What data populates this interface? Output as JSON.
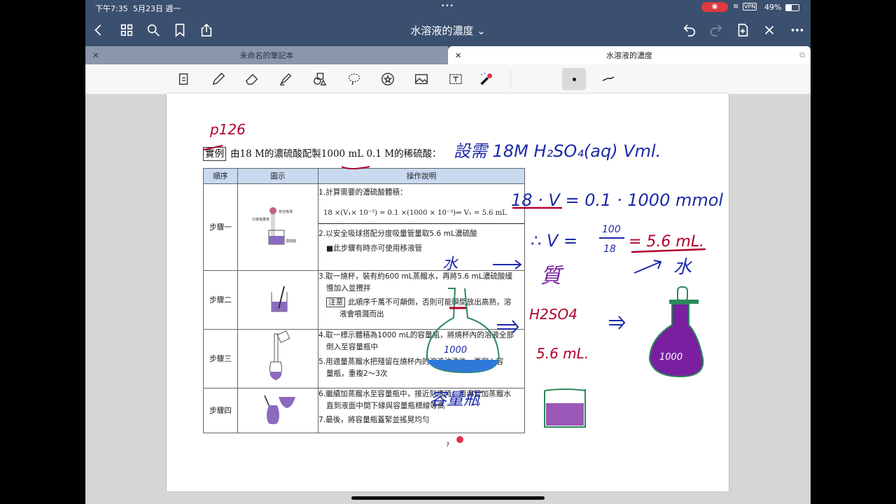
{
  "status": {
    "time": "下午7:35",
    "date": "5月23日 週一",
    "battery": "49%",
    "vpn": "VPN"
  },
  "nav": {
    "title": "水溶液的濃度 ⌄"
  },
  "tabs": [
    {
      "label": "未命名的筆記本"
    },
    {
      "label": "水溶液的濃度"
    }
  ],
  "document": {
    "example_tag": "實例",
    "heading": "由18 M的濃硫酸配製1000 mL 0.1 M的稀硫酸：",
    "columns": [
      "順序",
      "圖示",
      "操作說明"
    ],
    "steps": [
      {
        "label": "步驟一",
        "lines": [
          "1.計算需要的濃硫酸體積：",
          "18 ×(V₁× 10⁻³) = 0.1 ×(1000 × 10⁻³)⇒ V₁ = 5.6 mL",
          "2.以安全吸球搭配分度吸量管量取5.6 mL濃硫酸",
          "■此步驟有時亦可使用移液管"
        ],
        "fig_labels": [
          "安全吸球",
          "分度吸量管",
          "濃硫酸"
        ]
      },
      {
        "label": "步驟二",
        "lines": [
          "3.取一燒杯，裝有約600 mL蒸餾水，再將5.6 mL濃硫酸緩",
          "慢加入並攪拌",
          "注意",
          "此順序千萬不可顛倒，否則可能瞬間放出高熱，溶",
          "液會噴濺而出"
        ]
      },
      {
        "label": "步驟三",
        "lines": [
          "4.取一標示體積為1000 mL的容量瓶，將燒杯內的溶液全部",
          "倒入至容量瓶中",
          "5.用適量蒸餾水把殘留在燒杯內的溶液沖洗後，再倒入容",
          "量瓶，重複2～3次"
        ]
      },
      {
        "label": "步驟四",
        "lines": [
          "6.繼續加蒸餾水至容量瓶中，接近刻度時，用滴管加蒸餾水",
          "直到液面中間下緣與容量瓶標線等高",
          "7.最後，將容量瓶蓋緊並搖晃均勻"
        ]
      }
    ],
    "page_number": "7"
  },
  "handwriting": {
    "page_ref": "p126",
    "setup": "設需 18M H₂SO₄(aq) Vml.",
    "eq1": "18 · V = 0.1 · 1000 mmol",
    "eq2_prefix": "∴ V =",
    "frac_num": "100",
    "frac_den": "18",
    "eq2_result": "= 5.6 mL.",
    "water_left": "水",
    "water_right": "水",
    "zhi": "質",
    "acid": "H2SO4",
    "acid_vol": "5.6 mL.",
    "flask_left": "1000",
    "flask_right": "1000",
    "flask_caption": "容量瓶"
  },
  "colors": {
    "nav_bg": "#3b4f6f",
    "ink_blue": "#1c2aa8",
    "ink_red": "#b0002a",
    "ink_purple": "#7a1fa0",
    "ink_green": "#2a8a5a"
  }
}
